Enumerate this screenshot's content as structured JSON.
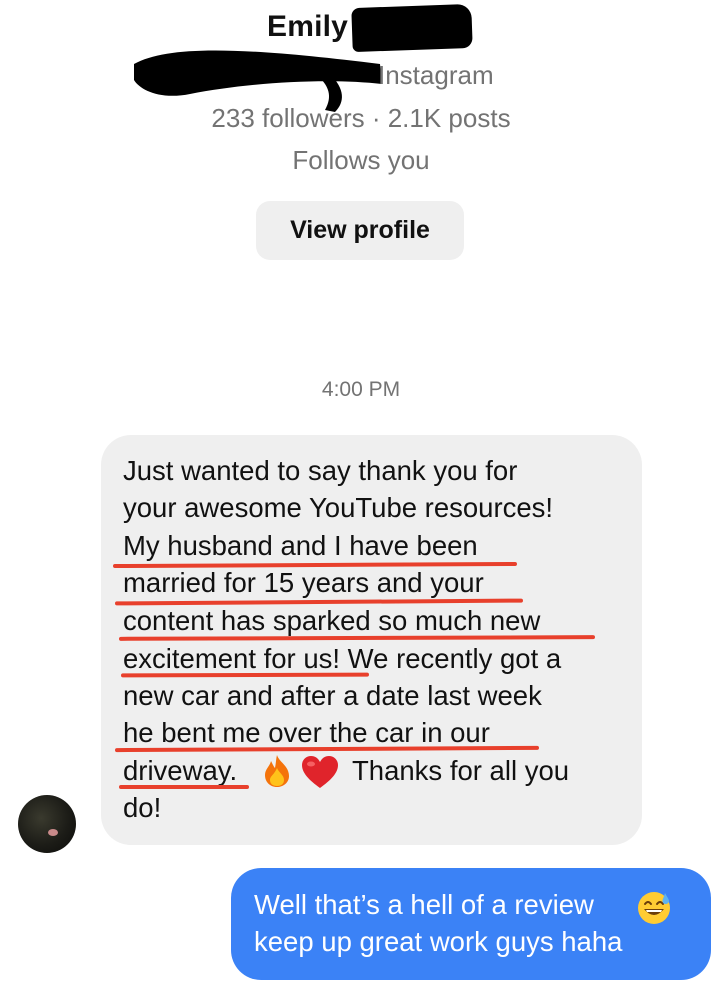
{
  "profile": {
    "name": "Emily",
    "platform": "Instagram",
    "stats": "233 followers · 2.1K posts",
    "follows_status": "Follows you",
    "view_profile_label": "View profile"
  },
  "thread": {
    "timestamp": "4:00 PM"
  },
  "incoming_message": {
    "lines": [
      "Just wanted to say thank you for",
      "your awesome YouTube resources!",
      "My husband and I have been",
      "married for 15 years and your",
      "content has sparked so much new",
      "excitement for us! We recently got a",
      "new car and after a date last week",
      "he bent me over the car in our",
      "driveway.",
      "Thanks for all you",
      "do!"
    ],
    "emojis": [
      "fire-emoji",
      "red-heart-emoji"
    ]
  },
  "outgoing_message": {
    "lines": [
      "Well that’s a hell of a review",
      "keep up great work guys haha"
    ],
    "emoji": "grinning-sweat-emoji"
  },
  "colors": {
    "incoming_bubble": "#efefef",
    "outgoing_bubble": "#3b82f6",
    "highlight_underline": "#e8402c",
    "secondary_text": "#737373",
    "redaction": "#000000"
  }
}
